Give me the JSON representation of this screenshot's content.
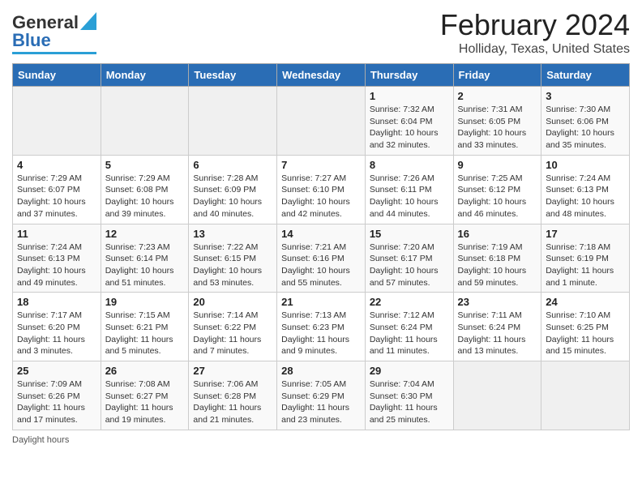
{
  "header": {
    "logo_line1": "General",
    "logo_line2": "Blue",
    "title": "February 2024",
    "subtitle": "Holliday, Texas, United States"
  },
  "weekdays": [
    "Sunday",
    "Monday",
    "Tuesday",
    "Wednesday",
    "Thursday",
    "Friday",
    "Saturday"
  ],
  "weeks": [
    [
      {
        "day": "",
        "info": ""
      },
      {
        "day": "",
        "info": ""
      },
      {
        "day": "",
        "info": ""
      },
      {
        "day": "",
        "info": ""
      },
      {
        "day": "1",
        "info": "Sunrise: 7:32 AM\nSunset: 6:04 PM\nDaylight: 10 hours\nand 32 minutes."
      },
      {
        "day": "2",
        "info": "Sunrise: 7:31 AM\nSunset: 6:05 PM\nDaylight: 10 hours\nand 33 minutes."
      },
      {
        "day": "3",
        "info": "Sunrise: 7:30 AM\nSunset: 6:06 PM\nDaylight: 10 hours\nand 35 minutes."
      }
    ],
    [
      {
        "day": "4",
        "info": "Sunrise: 7:29 AM\nSunset: 6:07 PM\nDaylight: 10 hours\nand 37 minutes."
      },
      {
        "day": "5",
        "info": "Sunrise: 7:29 AM\nSunset: 6:08 PM\nDaylight: 10 hours\nand 39 minutes."
      },
      {
        "day": "6",
        "info": "Sunrise: 7:28 AM\nSunset: 6:09 PM\nDaylight: 10 hours\nand 40 minutes."
      },
      {
        "day": "7",
        "info": "Sunrise: 7:27 AM\nSunset: 6:10 PM\nDaylight: 10 hours\nand 42 minutes."
      },
      {
        "day": "8",
        "info": "Sunrise: 7:26 AM\nSunset: 6:11 PM\nDaylight: 10 hours\nand 44 minutes."
      },
      {
        "day": "9",
        "info": "Sunrise: 7:25 AM\nSunset: 6:12 PM\nDaylight: 10 hours\nand 46 minutes."
      },
      {
        "day": "10",
        "info": "Sunrise: 7:24 AM\nSunset: 6:13 PM\nDaylight: 10 hours\nand 48 minutes."
      }
    ],
    [
      {
        "day": "11",
        "info": "Sunrise: 7:24 AM\nSunset: 6:13 PM\nDaylight: 10 hours\nand 49 minutes."
      },
      {
        "day": "12",
        "info": "Sunrise: 7:23 AM\nSunset: 6:14 PM\nDaylight: 10 hours\nand 51 minutes."
      },
      {
        "day": "13",
        "info": "Sunrise: 7:22 AM\nSunset: 6:15 PM\nDaylight: 10 hours\nand 53 minutes."
      },
      {
        "day": "14",
        "info": "Sunrise: 7:21 AM\nSunset: 6:16 PM\nDaylight: 10 hours\nand 55 minutes."
      },
      {
        "day": "15",
        "info": "Sunrise: 7:20 AM\nSunset: 6:17 PM\nDaylight: 10 hours\nand 57 minutes."
      },
      {
        "day": "16",
        "info": "Sunrise: 7:19 AM\nSunset: 6:18 PM\nDaylight: 10 hours\nand 59 minutes."
      },
      {
        "day": "17",
        "info": "Sunrise: 7:18 AM\nSunset: 6:19 PM\nDaylight: 11 hours\nand 1 minute."
      }
    ],
    [
      {
        "day": "18",
        "info": "Sunrise: 7:17 AM\nSunset: 6:20 PM\nDaylight: 11 hours\nand 3 minutes."
      },
      {
        "day": "19",
        "info": "Sunrise: 7:15 AM\nSunset: 6:21 PM\nDaylight: 11 hours\nand 5 minutes."
      },
      {
        "day": "20",
        "info": "Sunrise: 7:14 AM\nSunset: 6:22 PM\nDaylight: 11 hours\nand 7 minutes."
      },
      {
        "day": "21",
        "info": "Sunrise: 7:13 AM\nSunset: 6:23 PM\nDaylight: 11 hours\nand 9 minutes."
      },
      {
        "day": "22",
        "info": "Sunrise: 7:12 AM\nSunset: 6:24 PM\nDaylight: 11 hours\nand 11 minutes."
      },
      {
        "day": "23",
        "info": "Sunrise: 7:11 AM\nSunset: 6:24 PM\nDaylight: 11 hours\nand 13 minutes."
      },
      {
        "day": "24",
        "info": "Sunrise: 7:10 AM\nSunset: 6:25 PM\nDaylight: 11 hours\nand 15 minutes."
      }
    ],
    [
      {
        "day": "25",
        "info": "Sunrise: 7:09 AM\nSunset: 6:26 PM\nDaylight: 11 hours\nand 17 minutes."
      },
      {
        "day": "26",
        "info": "Sunrise: 7:08 AM\nSunset: 6:27 PM\nDaylight: 11 hours\nand 19 minutes."
      },
      {
        "day": "27",
        "info": "Sunrise: 7:06 AM\nSunset: 6:28 PM\nDaylight: 11 hours\nand 21 minutes."
      },
      {
        "day": "28",
        "info": "Sunrise: 7:05 AM\nSunset: 6:29 PM\nDaylight: 11 hours\nand 23 minutes."
      },
      {
        "day": "29",
        "info": "Sunrise: 7:04 AM\nSunset: 6:30 PM\nDaylight: 11 hours\nand 25 minutes."
      },
      {
        "day": "",
        "info": ""
      },
      {
        "day": "",
        "info": ""
      }
    ]
  ],
  "footer": {
    "note": "Daylight hours"
  }
}
